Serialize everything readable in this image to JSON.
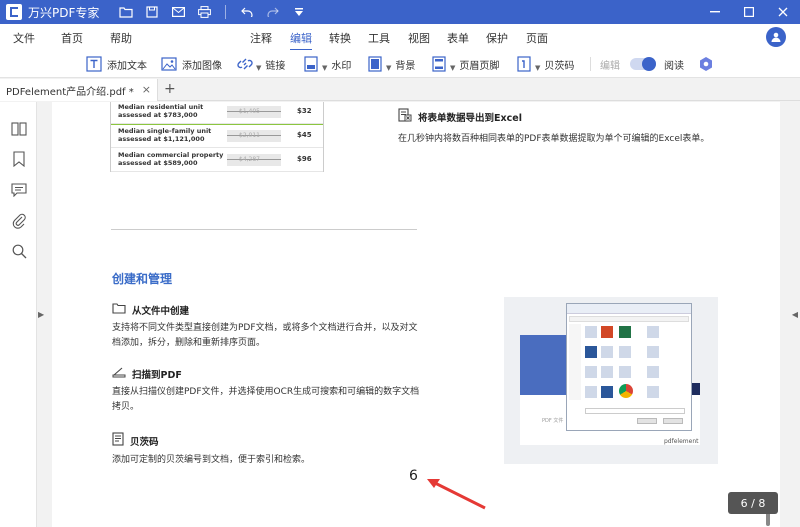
{
  "titlebar": {
    "app_title": "万兴PDF专家",
    "bg_color": "#3b63c9"
  },
  "menubar": {
    "items": [
      "文件",
      "首页",
      "帮助",
      "注释",
      "编辑",
      "转换",
      "工具",
      "视图",
      "表单",
      "保护",
      "页面"
    ],
    "active": "编辑"
  },
  "toolbar": {
    "add_text": "添加文本",
    "add_image": "添加图像",
    "link": "链接",
    "watermark": "水印",
    "background": "背景",
    "header_footer": "页眉页脚",
    "bates": "贝茨码",
    "edit": "编辑",
    "read": "阅读"
  },
  "tabs": {
    "doc_tab": "PDFelement产品介绍.pdf *",
    "close": "×",
    "new": "+"
  },
  "document": {
    "table_rows": [
      {
        "label": "Median residential unit assessed at $783,000",
        "bar": "$1,405",
        "value": "$32"
      },
      {
        "label": "Median single-family unit assessed at $1,121,000",
        "bar": "$2,011",
        "value": "$45"
      },
      {
        "label": "Median commercial property assessed at $589,000",
        "bar": "$4,287",
        "value": "$96"
      }
    ],
    "excel_feature": {
      "title": "将表单数据导出到Excel",
      "text": "在几秒钟内将数百种相同表单的PDF表单数据提取为单个可编辑的Excel表单。"
    },
    "section_title": "创建和管理",
    "features": [
      {
        "title": "从文件中创建",
        "text_lines": [
          "支持将不同文件类型直接创建为PDF文档，或将多个文档进行合并，以及对文",
          "档添加，拆分，删除和重新排序页面。"
        ]
      },
      {
        "title": "扫描到PDF",
        "text_lines": [
          "直接从扫描仪创建PDF文件，并选择使用OCR生成可搜索和可编辑的数字文档",
          "拷贝。"
        ]
      },
      {
        "title": "贝茨码",
        "text_lines": [
          "添加可定制的贝茨编号到文档，便于索引和检索。"
        ]
      }
    ],
    "page_number": "6",
    "illustration_brand": "pdfelement"
  },
  "page_indicator": "6 / 8",
  "accent_color": "#3b63c9",
  "arrow_color": "#e53935"
}
